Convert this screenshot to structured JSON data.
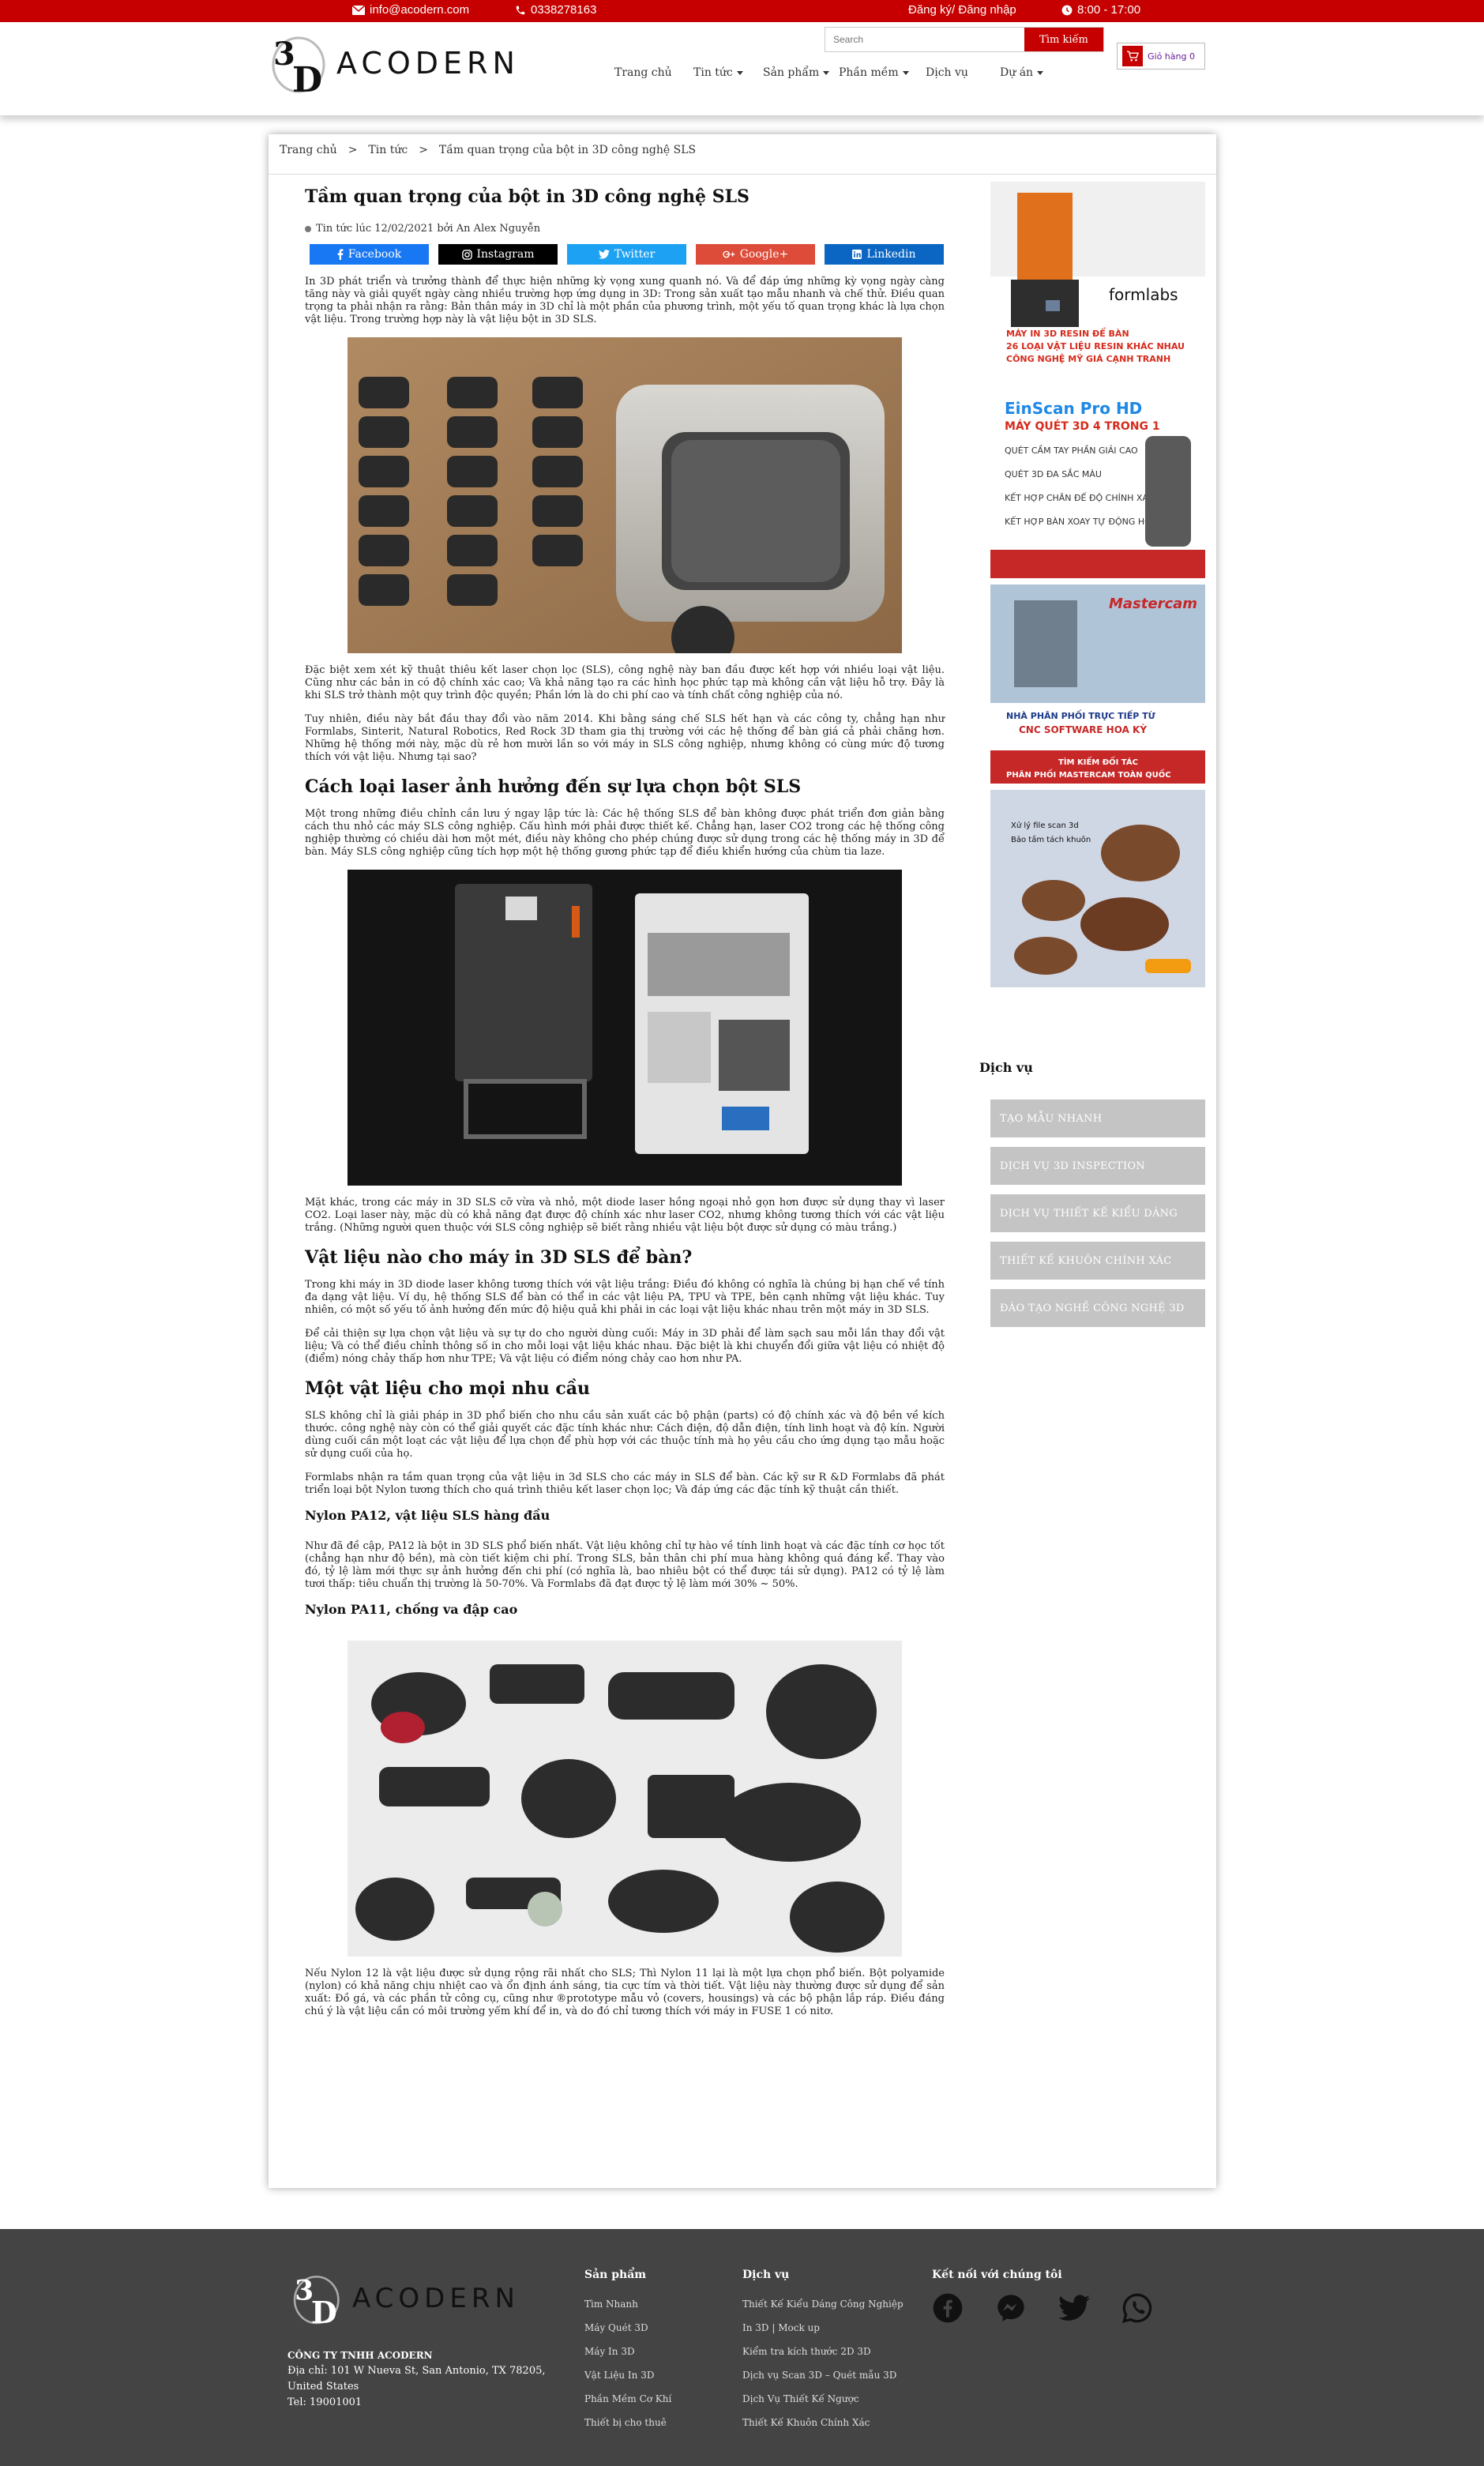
{
  "topbar": {
    "email": "info@acodern.com",
    "phone": "0338278163",
    "account": "Đăng ký/ Đăng nhập",
    "hours": "8:00 - 17:00"
  },
  "header": {
    "logo_text": "ACODERN",
    "search_placeholder": "Search",
    "search_button": "Tìm kiếm",
    "cart_label": "Giỏ hàng 0",
    "nav": [
      {
        "label": "Trang chủ",
        "dropdown": false
      },
      {
        "label": "Tin tức",
        "dropdown": true
      },
      {
        "label": "Sản phẩm",
        "dropdown": true
      },
      {
        "label": "Phần mềm",
        "dropdown": true
      },
      {
        "label": "Dịch vụ",
        "dropdown": false
      },
      {
        "label": "Dự án",
        "dropdown": true
      }
    ]
  },
  "breadcrumb": [
    "Trang chủ",
    ">",
    "Tin tức",
    ">",
    "Tầm quan trọng của bột in 3D công nghệ SLS"
  ],
  "article": {
    "title": "Tầm quan trọng của bột in 3D công nghệ SLS",
    "meta": "Tin tức lúc 12/02/2021 bởi An Alex Nguyễn",
    "share": [
      {
        "label": "Facebook",
        "color": "#1877f2",
        "icon": "facebook-icon"
      },
      {
        "label": "Instagram",
        "color": "#000000",
        "icon": "instagram-icon"
      },
      {
        "label": "Twitter",
        "color": "#1da1f2",
        "icon": "twitter-icon"
      },
      {
        "label": "Google+",
        "color": "#dd4b39",
        "icon": "google-plus-icon"
      },
      {
        "label": "Linkedin",
        "color": "#0a66c2",
        "icon": "linkedin-icon"
      }
    ],
    "p1": "In 3D phát triển và trưởng thành để thực hiện những kỳ vọng xung quanh nó. Và để đáp ứng những kỳ vọng ngày càng tăng này và giải quyết ngày càng nhiều trường hợp ứng dụng in 3D: Trong sản xuất tạo mẫu nhanh và chế thử. Điều quan trọng ta phải nhận ra rằng: Bản thân máy in 3D chỉ là một phần của phương trình, một yếu tố quan trọng khác là lựa chọn vật liệu. Trong trường hợp này là vật liệu bột in 3D SLS.",
    "p2": "Đặc biệt xem xét kỹ thuật thiêu kết laser chọn lọc (SLS), công nghệ này ban đầu được kết hợp với nhiều loại vật liệu. Cũng như các bản in có độ chính xác cao; Và khả năng tạo ra các hình học phức tạp mà không cần vật liệu hỗ trợ. Đây là khi SLS trở thành một quy trình độc quyền; Phần lớn là do chi phí cao và tính chất công nghiệp của nó.",
    "p3": "Tuy nhiên, điều này bắt đầu thay đổi vào năm 2014. Khi bằng sáng chế SLS hết hạn và các công ty, chẳng hạn như Formlabs, Sinterit, Natural Robotics, Red Rock 3D tham gia thị trường với các hệ thống để bàn giá cả phải chăng hơn. Những hệ thống mới này, mặc dù rẻ hơn mười lần so với máy in SLS công nghiệp, nhưng không có cùng mức độ tương thích với vật liệu. Nhưng tại sao?",
    "h2_1": "Cách loại laser ảnh hưởng đến sự lựa chọn bột SLS",
    "p4": "Một trong những điều chỉnh cần lưu ý ngay lập tức là: Các hệ thống SLS để bàn không được phát triển đơn giản bằng cách thu nhỏ các máy SLS công nghiệp. Cấu hình mới phải được thiết kế. Chẳng hạn, laser CO2 trong các hệ thống công nghiệp thường có chiều dài hơn một mét, điều này không cho phép chúng được sử dụng trong các hệ thống máy in 3D để bàn. Máy SLS công nghiệp cũng tích hợp một hệ thống gương phức tạp để điều khiển hướng của chùm tia laze.",
    "p5": "Mặt khác, trong các máy in 3D SLS cỡ vừa và nhỏ, một diode laser hồng ngoại nhỏ gọn hơn được sử dụng thay vì laser CO2. Loại laser này, mặc dù có khả năng đạt được độ chính xác như laser CO2, nhưng không tương thích với các vật liệu trắng. (Những người quen thuộc với SLS công nghiệp sẽ biết rằng nhiều vật liệu bột được sử dụng có màu trắng.)",
    "h2_2": "Vật liệu nào cho máy in 3D SLS để bàn?",
    "p6": "Trong khi máy in 3D diode laser không tương thích với vật liệu trắng: Điều đó không có nghĩa là chúng bị hạn chế về tính đa dạng vật liệu. Ví dụ, hệ thống SLS để bàn có thể in các vật liệu PA, TPU và TPE, bên cạnh những vật liệu khác. Tuy nhiên, có một số yếu tố ảnh hưởng đến mức độ hiệu quả khi phải in các loại vật liệu khác nhau trên một máy in 3D SLS.",
    "p7": "Để cải thiện sự lựa chọn vật liệu và sự tự do cho người dùng cuối: Máy in 3D phải để làm sạch sau mỗi lần thay đổi vật liệu; Và có thể điều chỉnh thông số in cho mỗi loại vật liệu khác nhau. Đặc biệt là khi chuyển đổi giữa vật liệu có nhiệt độ (điểm) nóng chảy thấp hơn như TPE; Và vật liệu có điểm nóng chảy cao hơn như PA.",
    "h2_3": "Một vật liệu cho mọi nhu cầu",
    "p8": "SLS không chỉ là giải pháp in 3D phổ biến cho nhu cầu sản xuất các bộ phận (parts) có độ chính xác và độ bền về kích thước. công nghệ này còn có thể giải quyết các đặc tính khác như: Cách điện, độ dẫn điện, tính linh hoạt và độ kín. Người dùng cuối cần một loạt các vật liệu để lựa chọn để phù hợp với các thuộc tính mà họ yêu cầu cho ứng dụng tạo mẫu hoặc sử dụng cuối của họ.",
    "p9": "Formlabs nhận ra tầm quan trọng của vật liệu in 3d SLS cho các máy in SLS để bàn. Các kỹ sư R &D Formlabs đã phát triển loại bột Nylon tương thích cho quá trình thiêu kết laser chọn lọc; Và đáp ứng các đặc tính kỹ thuật cần thiết.",
    "h3_1": "Nylon PA12, vật liệu SLS hàng đầu",
    "p10": "Như đã đề cập, PA12 là bột in 3D SLS phổ biến nhất. Vật liệu không chỉ tự hào về tính linh hoạt và các đặc tính cơ học tốt (chẳng hạn như độ bền), mà còn tiết kiệm chi phí. Trong SLS, bản thân chi phí mua hàng không quá đáng kể. Thay vào đó, tỷ lệ làm mới thực sự ảnh hưởng đến chi phí (có nghĩa là, bao nhiêu bột có thể được tái sử dụng). PA12 có tỷ lệ làm tươi thấp: tiêu chuẩn thị trường là 50-70%. Và Formlabs đã đạt được tỷ lệ làm mới 30% ~ 50%.",
    "h3_2": "Nylon PA11, chống va đập cao",
    "p11": "Nếu Nylon 12 là vật liệu được sử dụng rộng rãi nhất cho SLS; Thì Nylon 11 lại là một lựa chọn phổ biến. Bột polyamide (nylon) có khả năng chịu nhiệt cao và ổn định ánh sáng, tia cực tím và thời tiết. Vật liệu này thường được sử dụng để sản xuất: Đồ gá, và các phần tử công cụ, cũng như ®prototype mẫu vỏ (covers, housings) và các bộ phận lắp ráp. Điều đáng chú ý là vật liệu cần có môi trường yếm khí để in, và do đó chỉ tương thích với máy in FUSE 1 có nitơ."
  },
  "sidebar": {
    "ad1": {
      "brand": "formlabs",
      "lines": [
        "MÁY IN 3D RESIN ĐỂ BÀN",
        "26 LOẠI VẬT LIỆU RESIN KHÁC NHAU",
        "CÔNG NGHỆ MỸ GIÁ CẠNH TRANH"
      ]
    },
    "ad2": {
      "title": "EinScan Pro HD",
      "subtitle": "MÁY QUÉT 3D 4 TRONG 1",
      "lines": [
        "QUÉT CẦM TAY PHẦN GIẢI CAO",
        "QUÉT 3D ĐA SẮC MÀU",
        "KẾT HỢP CHÂN ĐẾ ĐỘ CHÍNH XÁC CAO",
        "KẾT HỢP BÀN XOAY TỰ ĐỘNG HOÀN TOÀN"
      ]
    },
    "ad3": {
      "brand": "Mastercam",
      "line1": "NHÀ PHÂN PHỐI TRỰC TIẾP TỪ",
      "line2": "CNC SOFTWARE HOA KỲ",
      "line3": "TÌM KIẾM ĐỐI TÁC",
      "line4": "PHÂN PHỐI MASTERCAM TOÀN QUỐC"
    },
    "ad4": {
      "lines": [
        "Xử lý file scan 3d",
        "Bảo tầm tách khuôn"
      ]
    },
    "services_title": "Dịch vụ",
    "services": [
      "TẠO MẪU NHANH",
      "DỊCH VỤ 3D INSPECTION",
      "DỊCH VỤ THIẾT KẾ KIỂU DÁNG",
      "THIẾT KẾ KHUÔN CHÍNH XÁC",
      "ĐÀO TẠO NGHỀ CÔNG NGHỆ 3D"
    ]
  },
  "footer": {
    "logo_text": "ACODERN",
    "company_name": "CÔNG TY TNHH ACODERN",
    "address": "Địa chỉ: 101 W Nueva St, San Antonio, TX 78205, United States",
    "phone": "Tel: 19001001",
    "products_title": "Sản phẩm",
    "products": [
      "Tìm Nhanh",
      "Máy Quét 3D",
      "Máy In 3D",
      "Vật Liệu In 3D",
      "Phần Mềm Cơ Khí",
      "Thiết bị cho thuê"
    ],
    "services_title": "Dịch vụ",
    "services": [
      "Thiết Kế Kiểu Dáng Công Nghiệp",
      "In 3D | Mock up",
      "Kiểm tra kích thước 2D 3D",
      "Dịch vụ Scan 3D – Quét mẫu 3D",
      "Dịch Vụ Thiết Kế Ngược",
      "Thiết Kế Khuôn Chính Xác"
    ],
    "social_title": "Kết nối với chúng tôi",
    "social": [
      "facebook-icon",
      "messenger-icon",
      "twitter-icon",
      "whatsapp-icon"
    ]
  }
}
